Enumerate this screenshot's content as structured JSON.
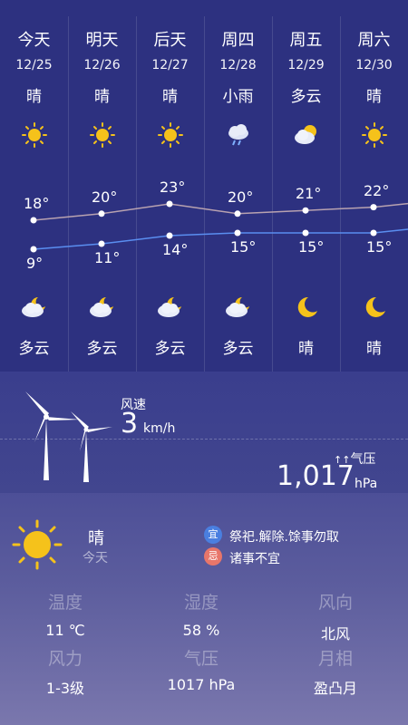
{
  "forecast": [
    {
      "day": "今天",
      "date": "12/25",
      "cond": "晴",
      "high": "18°",
      "low": "9°",
      "night_cond": "多云",
      "icon": "sun-icon",
      "night_icon": "cloud-moon-icon"
    },
    {
      "day": "明天",
      "date": "12/26",
      "cond": "晴",
      "high": "20°",
      "low": "11°",
      "night_cond": "多云",
      "icon": "sun-icon",
      "night_icon": "cloud-moon-icon"
    },
    {
      "day": "后天",
      "date": "12/27",
      "cond": "晴",
      "high": "23°",
      "low": "14°",
      "night_cond": "多云",
      "icon": "sun-icon",
      "night_icon": "cloud-moon-icon"
    },
    {
      "day": "周四",
      "date": "12/28",
      "cond": "小雨",
      "high": "20°",
      "low": "15°",
      "night_cond": "多云",
      "icon": "rain-cloud-icon",
      "night_icon": "cloud-moon-icon"
    },
    {
      "day": "周五",
      "date": "12/29",
      "cond": "多云",
      "high": "21°",
      "low": "15°",
      "night_cond": "晴",
      "icon": "cloud-sun-icon",
      "night_icon": "moon-icon"
    },
    {
      "day": "周六",
      "date": "12/30",
      "cond": "晴",
      "high": "22°",
      "low": "15°",
      "night_cond": "晴",
      "icon": "sun-icon",
      "night_icon": "moon-icon"
    }
  ],
  "temps": {
    "high": [
      18,
      20,
      23,
      20,
      21,
      22
    ],
    "low": [
      9,
      11,
      14,
      15,
      15,
      15
    ]
  },
  "wind": {
    "speed_label": "风速",
    "speed_value": "3",
    "speed_unit": "km/h"
  },
  "pressure": {
    "label": "气压",
    "value": "1,017",
    "unit": "hPa"
  },
  "today": {
    "cond": "晴",
    "label": "今天",
    "yi_badge": "宜",
    "yi_text": "祭祀.解除.馀事勿取",
    "ji_badge": "忌",
    "ji_text": "诸事不宜"
  },
  "details": [
    {
      "label": "温度",
      "value": "11 ℃"
    },
    {
      "label": "湿度",
      "value": "58 %"
    },
    {
      "label": "风向",
      "value": "北风"
    },
    {
      "label": "风力",
      "value": "1-3级"
    },
    {
      "label": "气压",
      "value": "1017 hPa"
    },
    {
      "label": "月相",
      "value": "盈凸月"
    }
  ],
  "colors": {
    "high_line": "#b8a2b0",
    "low_line": "#5a8ef0",
    "sun": "#f5c21b",
    "yi": "#4a7fe0",
    "ji": "#e8766a"
  }
}
